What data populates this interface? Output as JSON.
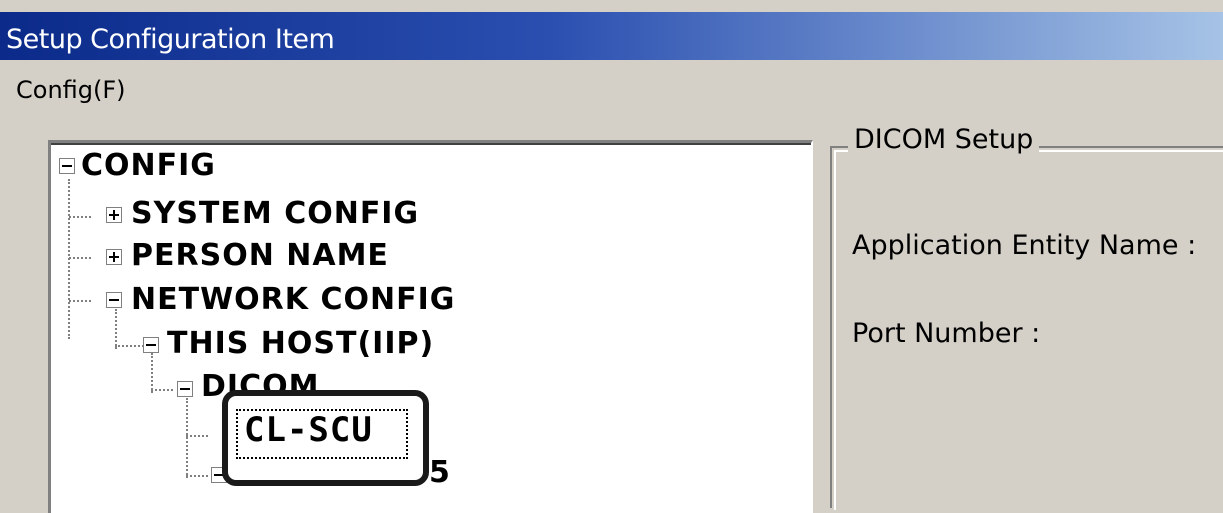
{
  "window": {
    "title": "Setup Configuration Item"
  },
  "menu": {
    "config_label": "Config(F)"
  },
  "tree": {
    "root": "CONFIG",
    "system_config": "SYSTEM CONFIG",
    "person_name": "PERSON NAME",
    "network_config": "NETWORK CONFIG",
    "this_host": "THIS HOST(IIP)",
    "dicom": "DICOM",
    "cl_scu": "CL-SCU",
    "dicom_iip_suffix": "5"
  },
  "dicom_setup": {
    "legend": "DICOM Setup",
    "ae_name_label": "Application Entity Name :",
    "port_label": "Port Number :"
  },
  "colors": {
    "title_bar_start": "#0b2a8a",
    "window_bg": "#d4d0c8"
  }
}
